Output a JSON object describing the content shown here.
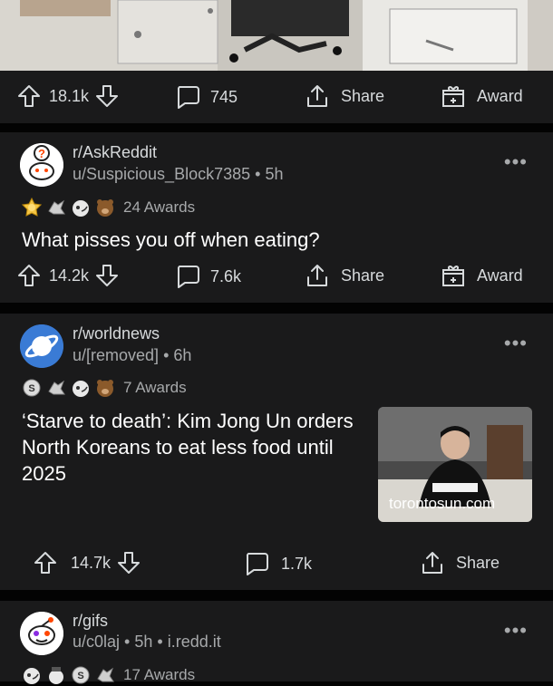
{
  "post1": {
    "upvotes": "18.1k",
    "comments": "745",
    "share": "Share",
    "award": "Award"
  },
  "post2": {
    "subreddit": "r/AskReddit",
    "user": "u/Suspicious_Block7385",
    "age": "5h",
    "awards_label": "24 Awards",
    "title": "What pisses you off when eating?",
    "upvotes": "14.2k",
    "comments": "7.6k",
    "share": "Share",
    "award": "Award",
    "award_icons": [
      "gold-award-icon",
      "wholesome-award-icon",
      "silver-award-icon",
      "bear-award-icon"
    ]
  },
  "post3": {
    "subreddit": "r/worldnews",
    "user": "u/[removed]",
    "age": "6h",
    "awards_label": "7 Awards",
    "title": "‘Starve to death’: Kim Jong Un orders North Koreans to eat less food until 2025",
    "thumb_domain": "torontosun.com",
    "upvotes": "14.7k",
    "comments": "1.7k",
    "share": "Share",
    "award_icons": [
      "silver-coin-award-icon",
      "wholesome-award-icon",
      "silver-award-icon",
      "bear-award-icon"
    ]
  },
  "post4": {
    "subreddit": "r/gifs",
    "user": "u/c0laj",
    "age": "5h",
    "domain": "i.redd.it",
    "awards_label": "17 Awards",
    "award_icons": [
      "silver-award-icon",
      "helpful-award-icon",
      "silver-coin-award-icon",
      "wholesome-award-icon"
    ]
  },
  "colors": {
    "background": "#030303",
    "card": "#1a1a1b",
    "text": "#d7dadc",
    "muted": "#a7a9ab",
    "worldnews": "#3a7bd5"
  }
}
